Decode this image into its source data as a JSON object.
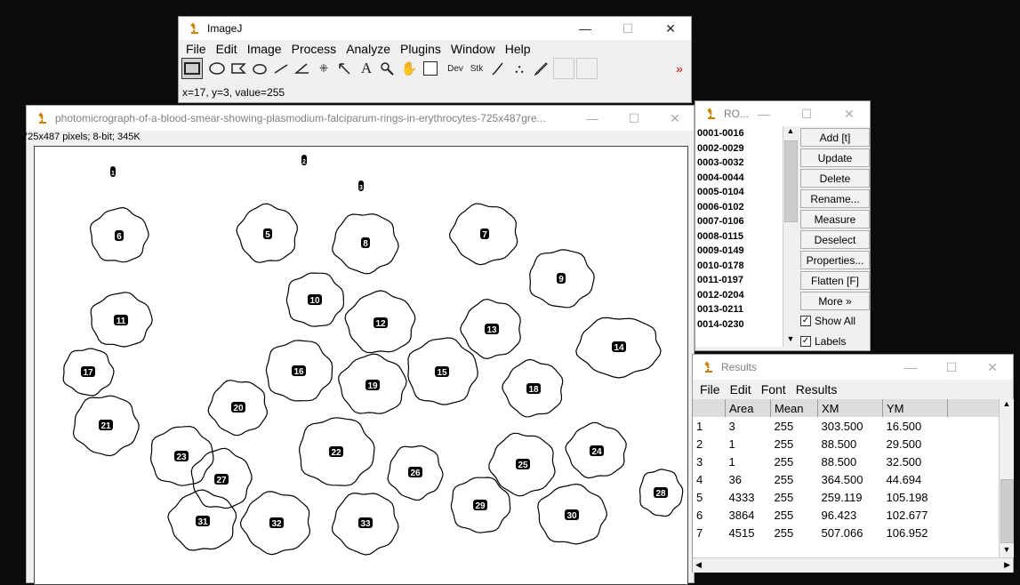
{
  "imagej": {
    "title": "ImageJ",
    "menu": [
      "File",
      "Edit",
      "Image",
      "Process",
      "Analyze",
      "Plugins",
      "Window",
      "Help"
    ],
    "tools": [
      "rectangle-tool",
      "oval-tool",
      "polygon-tool",
      "freehand-tool",
      "line-tool",
      "angle-tool",
      "point-tool",
      "wand-tool",
      "text-tool",
      "magnifier-tool",
      "hand-tool",
      "color-picker-tool"
    ],
    "dev_label": "Dev",
    "stk_label": "Stk",
    "more_label": "»",
    "status": "x=17, y=3, value=255"
  },
  "image_window": {
    "title": "photomicrograph-of-a-blood-smear-showing-plasmodium-falciparum-rings-in-erythrocytes-725x487gre...",
    "info": "725x487 pixels; 8-bit; 345K",
    "labels": [
      "1",
      "2",
      "3",
      "4",
      "5",
      "6",
      "7",
      "8",
      "9",
      "10",
      "11",
      "12",
      "13",
      "14",
      "15",
      "16",
      "17",
      "18",
      "19",
      "20",
      "21",
      "22",
      "23",
      "24",
      "25",
      "26",
      "27",
      "28",
      "29",
      "30",
      "31",
      "32",
      "33"
    ]
  },
  "roi_manager": {
    "title": "RO...",
    "items": [
      "0001-0016",
      "0002-0029",
      "0003-0032",
      "0004-0044",
      "0005-0104",
      "0006-0102",
      "0007-0106",
      "0008-0115",
      "0009-0149",
      "0010-0178",
      "0011-0197",
      "0012-0204",
      "0013-0211",
      "0014-0230"
    ],
    "buttons": [
      "Add [t]",
      "Update",
      "Delete",
      "Rename...",
      "Measure",
      "Deselect",
      "Properties...",
      "Flatten [F]",
      "More »"
    ],
    "show_all": "Show All",
    "labels": "Labels"
  },
  "results": {
    "title": "Results",
    "menu": [
      "File",
      "Edit",
      "Font",
      "Results"
    ],
    "columns": [
      "",
      "Area",
      "Mean",
      "XM",
      "YM"
    ],
    "rows": [
      [
        "1",
        "3",
        "255",
        "303.500",
        "16.500"
      ],
      [
        "2",
        "1",
        "255",
        "88.500",
        "29.500"
      ],
      [
        "3",
        "1",
        "255",
        "88.500",
        "32.500"
      ],
      [
        "4",
        "36",
        "255",
        "364.500",
        "44.694"
      ],
      [
        "5",
        "4333",
        "255",
        "259.119",
        "105.198"
      ],
      [
        "6",
        "3864",
        "255",
        "96.423",
        "102.677"
      ],
      [
        "7",
        "4515",
        "255",
        "507.066",
        "106.952"
      ]
    ]
  },
  "window_controls": {
    "minimize": "—",
    "maximize": "☐",
    "close": "✕"
  }
}
